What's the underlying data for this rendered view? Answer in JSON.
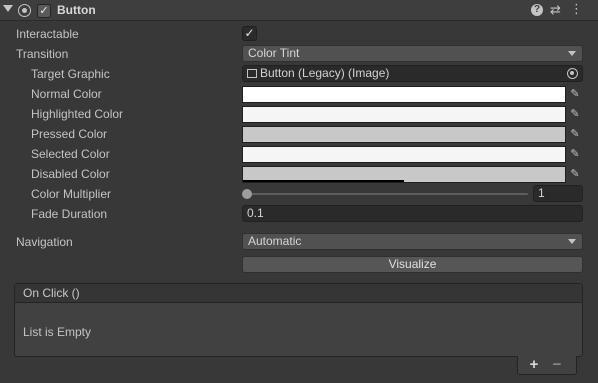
{
  "component": {
    "title": "Button",
    "enabled": true,
    "help_icon": "question-circle-icon",
    "preset_icon": "preset-sliders-icon",
    "menu_icon": "kebab-menu-icon"
  },
  "interactable": {
    "label": "Interactable",
    "checked_glyph": "✓"
  },
  "transition": {
    "label": "Transition",
    "value": "Color Tint"
  },
  "target_graphic": {
    "label": "Target Graphic",
    "value": "Button (Legacy) (Image)"
  },
  "colors": [
    {
      "label": "Normal Color",
      "color": "#ffffff",
      "alpha": 1.0
    },
    {
      "label": "Highlighted Color",
      "color": "#f5f5f5",
      "alpha": 1.0
    },
    {
      "label": "Pressed Color",
      "color": "#c8c8c8",
      "alpha": 1.0
    },
    {
      "label": "Selected Color",
      "color": "#f5f5f5",
      "alpha": 1.0
    },
    {
      "label": "Disabled Color",
      "color": "#c8c8c8",
      "alpha": 0.5
    }
  ],
  "color_multiplier": {
    "label": "Color Multiplier",
    "value": "1",
    "slider_fraction": 0.0
  },
  "fade_duration": {
    "label": "Fade Duration",
    "value": "0.1"
  },
  "navigation": {
    "label": "Navigation",
    "value": "Automatic",
    "visualize_label": "Visualize"
  },
  "on_click": {
    "header": "On Click ()",
    "empty_text": "List is Empty",
    "add_glyph": "+",
    "remove_glyph": "−"
  },
  "colors_theme": {
    "background": "#383838",
    "header": "#3e3e3e",
    "field": "#2a2a2a",
    "text": "#c4c4c4"
  }
}
